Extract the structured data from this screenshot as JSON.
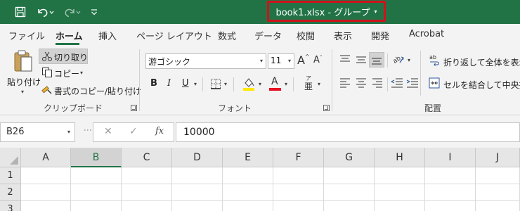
{
  "app": {
    "window_title": "book1.xlsx  -  グループ",
    "title_dropdown_glyph": "▾",
    "accent_color": "#217346",
    "highlight_color": "#d0121b"
  },
  "quick_access": {
    "save_icon": "save-icon",
    "undo_icon": "undo-icon",
    "redo_icon": "redo-icon",
    "customize_icon": "customize-quick-access-icon"
  },
  "tabs": [
    "ファイル",
    "ホーム",
    "挿入",
    "ページ レイアウト",
    "数式",
    "データ",
    "校閲",
    "表示",
    "開発",
    "Acrobat"
  ],
  "active_tab": "ホーム",
  "ribbon": {
    "clipboard": {
      "paste": "貼り付け",
      "cut": "切り取り",
      "copy": "コピー",
      "format_painter": "書式のコピー/貼り付け",
      "group_label": "クリップボード"
    },
    "font": {
      "font_name": "游ゴシック",
      "font_size": "11",
      "grow": "A",
      "shrink": "A",
      "bold": "B",
      "italic": "I",
      "underline": "U",
      "font_color_letter": "A",
      "phonetic": "ア",
      "phonetic_sub": "亜",
      "group_label": "フォント"
    },
    "alignment": {
      "wrap_text": "折り返して全体を表示す",
      "merge_center": "セルを結合して中央揃え",
      "group_label": "配置"
    }
  },
  "formula_bar": {
    "name_box": "B26",
    "cancel": "✕",
    "enter": "✓",
    "function": "fx",
    "value": "10000"
  },
  "grid": {
    "columns": [
      "A",
      "B",
      "C",
      "D",
      "E",
      "F",
      "G",
      "H",
      "I",
      "J"
    ],
    "selected_column": "B",
    "rows": [
      "1",
      "2",
      "3"
    ]
  }
}
